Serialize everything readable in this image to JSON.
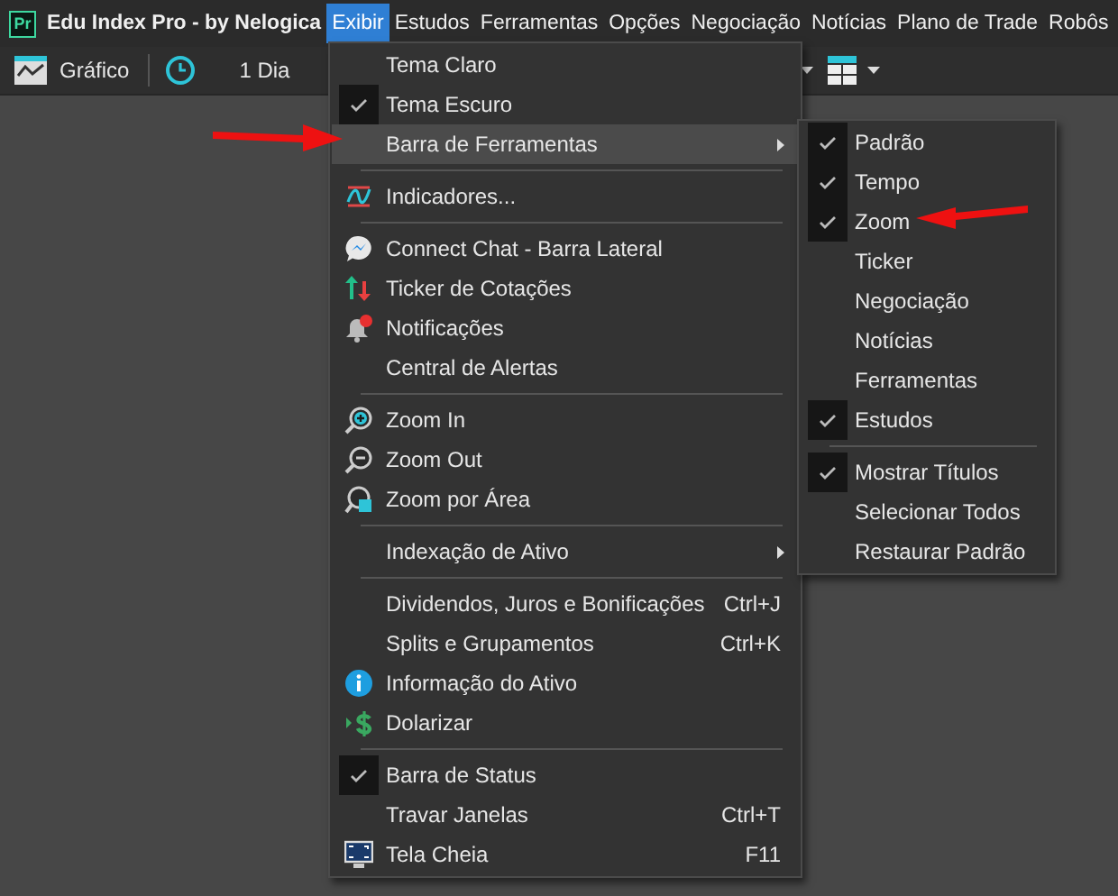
{
  "app": {
    "logo": "Pr",
    "title": "Edu Index Pro - by Nelogica"
  },
  "menubar": [
    {
      "label": "Exibir",
      "selected": true
    },
    {
      "label": "Estudos",
      "selected": false
    },
    {
      "label": "Ferramentas",
      "selected": false
    },
    {
      "label": "Opções",
      "selected": false
    },
    {
      "label": "Negociação",
      "selected": false
    },
    {
      "label": "Notícias",
      "selected": false
    },
    {
      "label": "Plano de Trade",
      "selected": false
    },
    {
      "label": "Robôs",
      "selected": false
    }
  ],
  "toolbar": {
    "chart_button": "Gráfico",
    "interval": "1 Dia"
  },
  "menu": {
    "items": [
      {
        "kind": "item",
        "label": "Tema Claro",
        "checked": false,
        "selected": false
      },
      {
        "kind": "item",
        "label": "Tema Escuro",
        "checked": true,
        "selected": false
      },
      {
        "kind": "item",
        "label": "Barra de Ferramentas",
        "checked": false,
        "selected": true,
        "submenu": true
      },
      {
        "kind": "separator"
      },
      {
        "kind": "wave",
        "label": "Indicadores...",
        "checked": false,
        "selected": false
      },
      {
        "kind": "separator"
      },
      {
        "kind": "chat",
        "label": "Connect Chat - Barra Lateral",
        "checked": false,
        "selected": false
      },
      {
        "kind": "arrows",
        "label": "Ticker de Cotações",
        "checked": false,
        "selected": false
      },
      {
        "kind": "bell",
        "label": "Notificações",
        "checked": false,
        "selected": false
      },
      {
        "kind": "item",
        "label": "Central de Alertas",
        "checked": false,
        "selected": false
      },
      {
        "kind": "separator"
      },
      {
        "kind": "zoomin",
        "label": "Zoom In",
        "checked": false,
        "selected": false
      },
      {
        "kind": "zoomout",
        "label": "Zoom Out",
        "checked": false,
        "selected": false
      },
      {
        "kind": "zoomarea",
        "label": "Zoom por Área",
        "checked": false,
        "selected": false
      },
      {
        "kind": "separator"
      },
      {
        "kind": "item",
        "label": "Indexação de Ativo",
        "checked": false,
        "selected": false,
        "submenu": true
      },
      {
        "kind": "separator"
      },
      {
        "kind": "item",
        "label": "Dividendos, Juros e Bonificações",
        "checked": false,
        "selected": false,
        "shortcut": "Ctrl+J"
      },
      {
        "kind": "item",
        "label": "Splits e Grupamentos",
        "checked": false,
        "selected": false,
        "shortcut": "Ctrl+K"
      },
      {
        "kind": "info",
        "label": "Informação do Ativo",
        "checked": false,
        "selected": false
      },
      {
        "kind": "dollar",
        "label": "Dolarizar",
        "checked": false,
        "selected": false
      },
      {
        "kind": "separator"
      },
      {
        "kind": "item",
        "label": "Barra de Status",
        "checked": true,
        "selected": false
      },
      {
        "kind": "item",
        "label": "Travar Janelas",
        "checked": false,
        "selected": false,
        "shortcut": "Ctrl+T"
      },
      {
        "kind": "monitor",
        "label": "Tela Cheia",
        "checked": false,
        "selected": false,
        "shortcut": "F11"
      }
    ]
  },
  "submenu": {
    "items": [
      {
        "kind": "item",
        "label": "Padrão",
        "checked": true,
        "selected": false
      },
      {
        "kind": "item",
        "label": "Tempo",
        "checked": true,
        "selected": false
      },
      {
        "kind": "item",
        "label": "Zoom",
        "checked": true,
        "selected": false
      },
      {
        "kind": "item",
        "label": "Ticker",
        "checked": false,
        "selected": false
      },
      {
        "kind": "item",
        "label": "Negociação",
        "checked": false,
        "selected": false
      },
      {
        "kind": "item",
        "label": "Notícias",
        "checked": false,
        "selected": false
      },
      {
        "kind": "item",
        "label": "Ferramentas",
        "checked": false,
        "selected": false
      },
      {
        "kind": "item",
        "label": "Estudos",
        "checked": true,
        "selected": false
      },
      {
        "kind": "separator"
      },
      {
        "kind": "item",
        "label": "Mostrar Títulos",
        "checked": true,
        "selected": false
      },
      {
        "kind": "item",
        "label": "Selecionar Todos",
        "checked": false,
        "selected": false
      },
      {
        "kind": "item",
        "label": "Restaurar Padrão",
        "checked": false,
        "selected": false
      }
    ]
  }
}
